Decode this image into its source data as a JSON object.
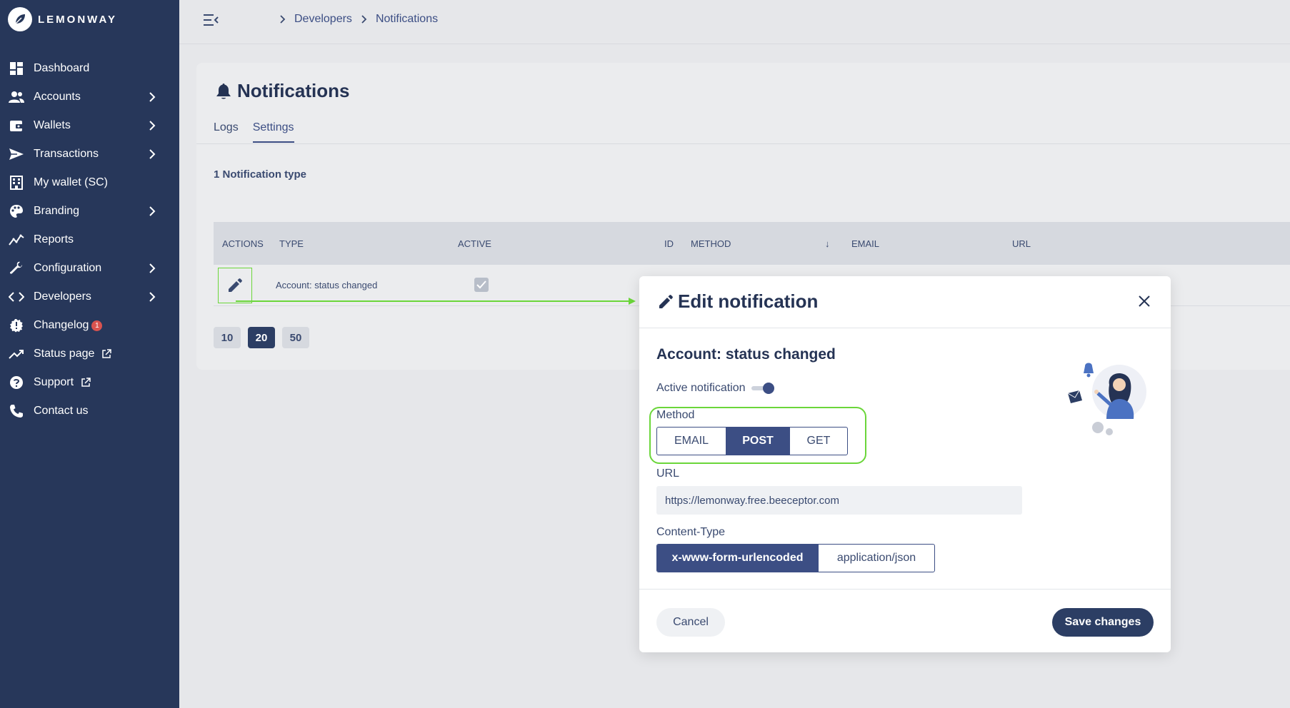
{
  "brand": {
    "name": "LEMONWAY"
  },
  "sidebar": {
    "items": [
      {
        "label": "Dashboard"
      },
      {
        "label": "Accounts"
      },
      {
        "label": "Wallets"
      },
      {
        "label": "Transactions"
      },
      {
        "label": "My wallet (SC)"
      },
      {
        "label": "Branding"
      },
      {
        "label": "Reports"
      },
      {
        "label": "Configuration"
      },
      {
        "label": "Developers"
      },
      {
        "label": "Changelog",
        "badge": "1"
      },
      {
        "label": "Status page"
      },
      {
        "label": "Support"
      },
      {
        "label": "Contact us"
      }
    ]
  },
  "breadcrumb": {
    "items": [
      "Developers",
      "Notifications"
    ]
  },
  "page": {
    "title": "Notifications",
    "tabs": [
      {
        "label": "Logs"
      },
      {
        "label": "Settings",
        "active": true
      }
    ],
    "count_label": "1 Notification type"
  },
  "table": {
    "columns": [
      "ACTIONS",
      "TYPE",
      "ACTIVE",
      "ID",
      "METHOD",
      "EMAIL",
      "URL"
    ],
    "rows": [
      {
        "type": "Account: status changed",
        "active": true
      }
    ],
    "page_sizes": [
      "10",
      "20",
      "50"
    ],
    "selected_page_size": "20"
  },
  "modal": {
    "title": "Edit notification",
    "notification_name": "Account: status changed",
    "active_label": "Active notification",
    "active": true,
    "method_label": "Method",
    "methods": [
      "EMAIL",
      "POST",
      "GET"
    ],
    "selected_method": "POST",
    "url_label": "URL",
    "url_value": "https://lemonway.free.beeceptor.com",
    "content_type_label": "Content-Type",
    "content_types": [
      "x-www-form-urlencoded",
      "application/json"
    ],
    "selected_content_type": "x-www-form-urlencoded",
    "cancel_label": "Cancel",
    "save_label": "Save changes"
  },
  "colors": {
    "sidebar_bg": "#27375a",
    "accent": "#3c4e84",
    "primary_button": "#2c3e64",
    "annotation_highlight": "#6bd63a",
    "badge": "#d9534f"
  },
  "icons": {
    "sidebar": [
      "dashboard-icon",
      "accounts-icon",
      "wallet-icon",
      "transactions-icon",
      "building-icon",
      "palette-icon",
      "reports-icon",
      "wrench-icon",
      "code-icon",
      "changelog-icon",
      "status-icon",
      "support-icon",
      "phone-icon"
    ],
    "other": [
      "menu-toggle-icon",
      "bell-icon",
      "pencil-icon",
      "close-icon",
      "check-icon",
      "external-link-icon",
      "chevron-right-icon"
    ]
  }
}
